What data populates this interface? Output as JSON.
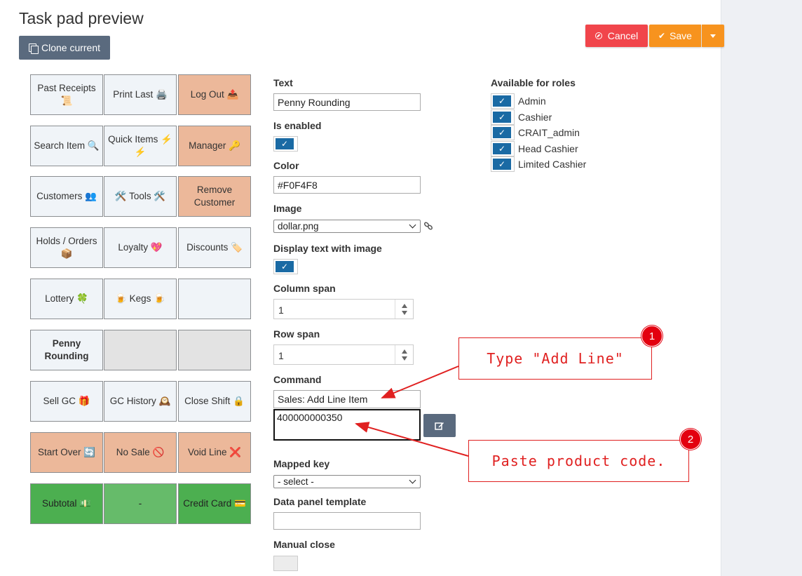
{
  "header": {
    "title": "Task pad preview",
    "clone_label": "Clone current",
    "cancel_label": "Cancel",
    "save_label": "Save"
  },
  "tiles": [
    {
      "label": "Past Receipts 📜",
      "style": "default"
    },
    {
      "label": "Print Last 🖨️",
      "style": "default"
    },
    {
      "label": "Log Out 📤",
      "style": "orange"
    },
    {
      "label": "Search Item 🔍",
      "style": "default"
    },
    {
      "label": "Quick Items ⚡ ⚡",
      "style": "default"
    },
    {
      "label": "Manager 🔑",
      "style": "orange"
    },
    {
      "label": "Customers 👥",
      "style": "default"
    },
    {
      "label": "🛠️ Tools 🛠️",
      "style": "default"
    },
    {
      "label": "Remove Customer",
      "style": "orange"
    },
    {
      "label": "Holds / Orders 📦",
      "style": "default"
    },
    {
      "label": "Loyalty 💖",
      "style": "default"
    },
    {
      "label": "Discounts 🏷️",
      "style": "default"
    },
    {
      "label": "Lottery 🍀",
      "style": "default"
    },
    {
      "label": "🍺 Kegs 🍺",
      "style": "default"
    },
    {
      "label": "",
      "style": "default"
    },
    {
      "label": "Penny Rounding",
      "style": "bold"
    },
    {
      "label": "",
      "style": "grey"
    },
    {
      "label": "",
      "style": "grey"
    },
    {
      "label": "Sell GC 🎁",
      "style": "default"
    },
    {
      "label": "GC History 🕰️",
      "style": "default"
    },
    {
      "label": "Close Shift 🔒",
      "style": "default"
    },
    {
      "label": "Start Over 🔄",
      "style": "orange"
    },
    {
      "label": "No Sale 🚫",
      "style": "orange"
    },
    {
      "label": "Void Line ❌",
      "style": "orange"
    },
    {
      "label": "Subtotal 💵",
      "style": "green"
    },
    {
      "label": "-",
      "style": "green-light"
    },
    {
      "label": "Credit Card 💳",
      "style": "green"
    }
  ],
  "form": {
    "text_label": "Text",
    "text_value": "Penny Rounding",
    "enabled_label": "Is enabled",
    "enabled": true,
    "color_label": "Color",
    "color_value": "#F0F4F8",
    "image_label": "Image",
    "image_value": "dollar.png",
    "display_text_label": "Display text with image",
    "display_text": true,
    "column_span_label": "Column span",
    "column_span_value": "1",
    "row_span_label": "Row span",
    "row_span_value": "1",
    "command_label": "Command",
    "command_value": "Sales: Add Line Item",
    "command_arg_value": "400000000350",
    "mapped_key_label": "Mapped key",
    "mapped_key_value": "- select -",
    "data_panel_label": "Data panel template",
    "data_panel_value": "",
    "manual_close_label": "Manual close",
    "manual_close": false
  },
  "roles": {
    "title": "Available for roles",
    "items": [
      {
        "label": "Admin",
        "checked": true
      },
      {
        "label": "Cashier",
        "checked": true
      },
      {
        "label": "CRAIT_admin",
        "checked": true
      },
      {
        "label": "Head Cashier",
        "checked": true
      },
      {
        "label": "Limited Cashier",
        "checked": true
      }
    ]
  },
  "annotations": [
    {
      "number": "1",
      "text": "Type \"Add Line\""
    },
    {
      "number": "2",
      "text": "Paste product code."
    }
  ],
  "colors": {
    "primary": "#1a6aa4",
    "danger": "#f1454b",
    "warning": "#f7931e",
    "annotation": "#e02020"
  }
}
